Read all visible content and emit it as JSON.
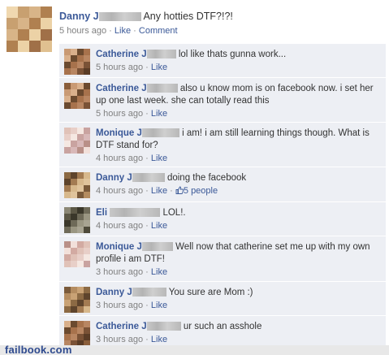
{
  "post": {
    "author": "Danny J",
    "text": "Any hotties DTF?!?!",
    "time": "5 hours ago",
    "sep1": "·",
    "like": "Like",
    "sep2": "·",
    "comment": "Comment"
  },
  "comments": [
    {
      "author": "Catherine J",
      "text": "lol like thats gunna work...",
      "time": "5 hours ago",
      "sep": "·",
      "like": "Like"
    },
    {
      "author": "Catherine J",
      "text": "also u know mom is on facebook now. i set her up one last week. she can totally read this",
      "time": "5 hours ago",
      "sep": "·",
      "like": "Like"
    },
    {
      "author": "Monique J",
      "text": "i am! i am still learning things though. What is DTF stand for?",
      "time": "4 hours ago",
      "sep": "·",
      "like": "Like"
    },
    {
      "author": "Danny J",
      "text": "doing the facebook",
      "time": "4 hours ago",
      "sep": "·",
      "like": "Like",
      "sep2": "·",
      "likes_count": "5 people"
    },
    {
      "author": "Eli",
      "text": "LOL!.",
      "time": "4 hours ago",
      "sep": "·",
      "like": "Like"
    },
    {
      "author": "Monique J",
      "text": "Well now that catherine set me up with my own profile i am DTF!",
      "time": "3 hours ago",
      "sep": "·",
      "like": "Like"
    },
    {
      "author": "Danny J",
      "text": "You sure are Mom :)",
      "time": "3 hours ago",
      "sep": "·",
      "like": "Like"
    },
    {
      "author": "Catherine J",
      "text": "ur such an asshole",
      "time": "3 hours ago",
      "sep": "·",
      "like": "Like"
    }
  ],
  "watermark": "failbook.com",
  "icons": {
    "likes": "thumbs-up-icon"
  },
  "colors": {
    "link": "#3b5998",
    "comment_bg": "#edeff4",
    "meta": "#808080"
  }
}
